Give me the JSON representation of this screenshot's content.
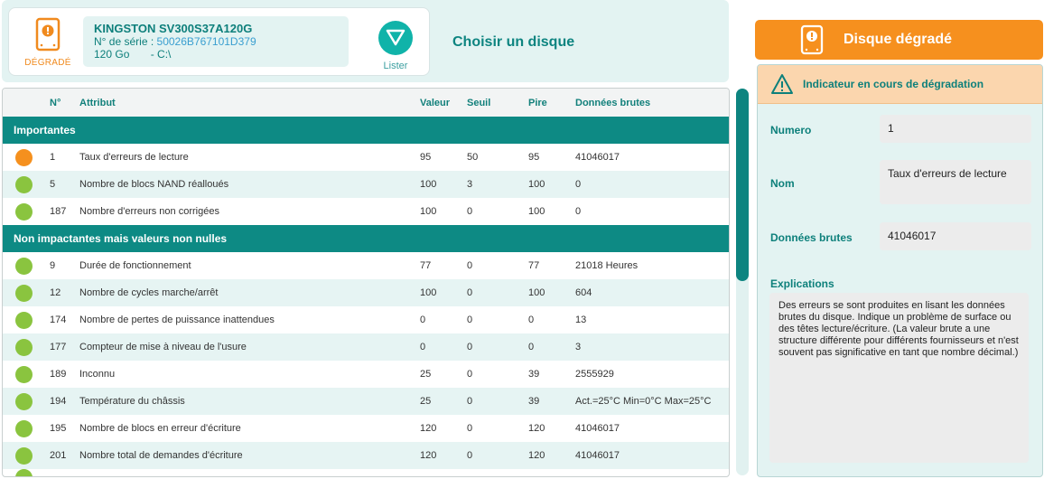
{
  "disk": {
    "status_label": "DÉGRADÉ",
    "model": "KINGSTON SV300S37A120G",
    "serial_label": "N° de série :",
    "serial": "50026B767101D379",
    "capacity": "120 Go",
    "drive": "- C:\\"
  },
  "toolbar": {
    "list_label": "Lister",
    "choose_label": "Choisir un disque"
  },
  "table": {
    "headers": {
      "num": "N°",
      "attr": "Attribut",
      "value": "Valeur",
      "threshold": "Seuil",
      "worst": "Pire",
      "raw": "Données brutes"
    },
    "groups": [
      {
        "name": "Importantes",
        "rows": [
          {
            "status": "warn",
            "num": "1",
            "attr": "Taux d'erreurs de lecture",
            "value": "95",
            "threshold": "50",
            "worst": "95",
            "raw": "41046017"
          },
          {
            "status": "ok",
            "num": "5",
            "attr": "Nombre de blocs NAND réalloués",
            "value": "100",
            "threshold": "3",
            "worst": "100",
            "raw": "0"
          },
          {
            "status": "ok",
            "num": "187",
            "attr": "Nombre d'erreurs non corrigées",
            "value": "100",
            "threshold": "0",
            "worst": "100",
            "raw": "0"
          }
        ]
      },
      {
        "name": "Non impactantes mais valeurs non nulles",
        "rows": [
          {
            "status": "ok",
            "num": "9",
            "attr": "Durée de fonctionnement",
            "value": "77",
            "threshold": "0",
            "worst": "77",
            "raw": "21018 Heures"
          },
          {
            "status": "ok",
            "num": "12",
            "attr": "Nombre de cycles marche/arrêt",
            "value": "100",
            "threshold": "0",
            "worst": "100",
            "raw": "604"
          },
          {
            "status": "ok",
            "num": "174",
            "attr": "Nombre de pertes de puissance inattendues",
            "value": "0",
            "threshold": "0",
            "worst": "0",
            "raw": "13"
          },
          {
            "status": "ok",
            "num": "177",
            "attr": "Compteur de mise à niveau de l'usure",
            "value": "0",
            "threshold": "0",
            "worst": "0",
            "raw": "3"
          },
          {
            "status": "ok",
            "num": "189",
            "attr": "Inconnu",
            "value": "25",
            "threshold": "0",
            "worst": "39",
            "raw": "2555929"
          },
          {
            "status": "ok",
            "num": "194",
            "attr": "Température du châssis",
            "value": "25",
            "threshold": "0",
            "worst": "39",
            "raw": "Act.=25°C Min=0°C Max=25°C"
          },
          {
            "status": "ok",
            "num": "195",
            "attr": "Nombre de blocs en erreur d'écriture",
            "value": "120",
            "threshold": "0",
            "worst": "120",
            "raw": "41046017"
          },
          {
            "status": "ok",
            "num": "201",
            "attr": "Nombre total de demandes d'écriture",
            "value": "120",
            "threshold": "0",
            "worst": "120",
            "raw": "41046017"
          }
        ]
      }
    ]
  },
  "right_panel": {
    "banner": "Disque dégradé",
    "indicator": "Indicateur en cours de dégradation",
    "number_label": "Numero",
    "number_value": "1",
    "name_label": "Nom",
    "name_value": "Taux d'erreurs de lecture",
    "raw_label": "Données brutes",
    "raw_value": "41046017",
    "expl_label": "Explications",
    "expl_text": "Des erreurs se sont produites en lisant les données brutes du disque. Indique un problème de surface ou des têtes lecture/écriture. (La valeur brute a une structure différente pour différents fournisseurs et n'est souvent pas significative en tant que nombre décimal.)"
  },
  "colors": {
    "teal": "#0d8a84",
    "ok": "#8ac43f",
    "warn": "#f5901e"
  }
}
